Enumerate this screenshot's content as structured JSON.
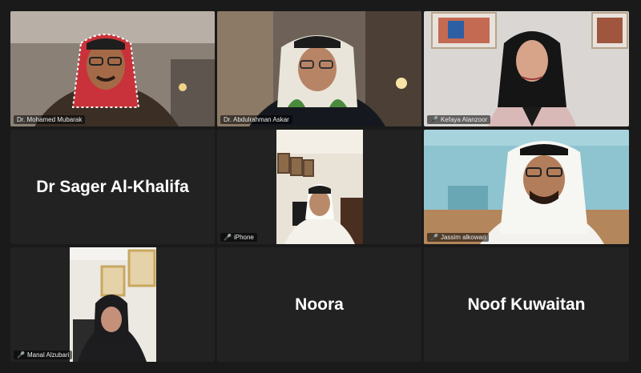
{
  "participants": [
    {
      "name": "Dr. Mohamed Mubarak",
      "muted": false
    },
    {
      "name": "Dr. Abdulrahman Askar",
      "muted": false
    },
    {
      "name": "Kefaya Alanzoor",
      "muted": true
    },
    {
      "name": "Dr Sager Al-Khalifa",
      "muted": false
    },
    {
      "name": "iPhone",
      "muted": true
    },
    {
      "name": "Jassim alkowari",
      "muted": true
    },
    {
      "name": "Manal Alzubari",
      "muted": true
    },
    {
      "name": "Noora",
      "muted": false
    },
    {
      "name": "Noof Kuwaitan",
      "muted": false
    }
  ],
  "icons": {
    "muted": "mic-muted-icon"
  },
  "colors": {
    "background": "#1a1a1a",
    "tile": "#222222",
    "muted_icon": "#e53935"
  }
}
